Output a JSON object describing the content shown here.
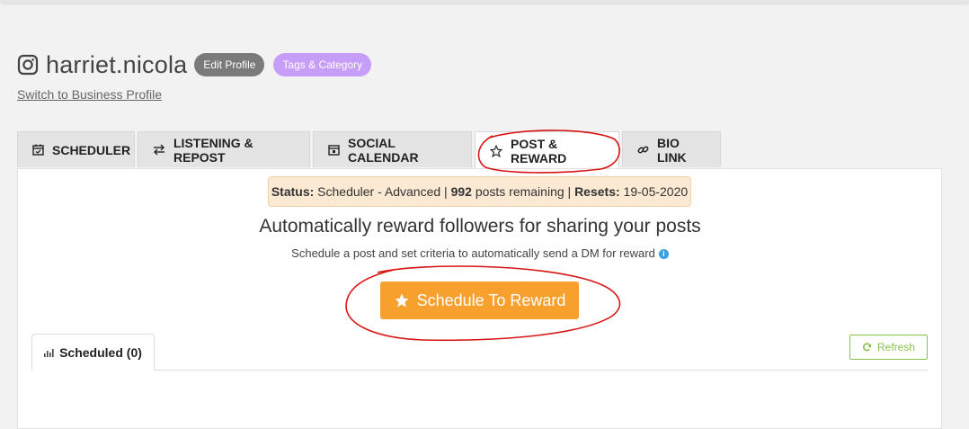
{
  "profile": {
    "username": "harriet.nicola",
    "edit_label": "Edit Profile",
    "tags_label": "Tags & Category",
    "switch_label": "Switch to Business Profile",
    "icon": "instagram-icon"
  },
  "tabs": [
    {
      "label": "SCHEDULER",
      "icon": "calendar-check-icon"
    },
    {
      "label": "LISTENING & REPOST",
      "icon": "repost-icon"
    },
    {
      "label": "SOCIAL CALENDAR",
      "icon": "calendar-icon"
    },
    {
      "label": "POST & REWARD",
      "icon": "star-outline-icon",
      "active": true
    },
    {
      "label": "BIO LINK",
      "icon": "link-icon"
    }
  ],
  "status": {
    "status_key": "Status:",
    "status_value": "Scheduler - Advanced |",
    "posts_count": "992",
    "posts_text": "posts remaining |",
    "resets_key": "Resets:",
    "resets_value": "19-05-2020"
  },
  "main": {
    "headline": "Automatically reward followers for sharing your posts",
    "subline": "Schedule a post and set criteria to automatically send a DM for reward",
    "cta_label": "Schedule To Reward"
  },
  "lower": {
    "scheduled_label": "Scheduled (0)",
    "refresh_label": "Refresh"
  },
  "colors": {
    "accent_orange": "#f8a02e",
    "tags_purple": "#c79dfa",
    "refresh_green": "#8bc34a",
    "annotation_red": "#d81414"
  }
}
